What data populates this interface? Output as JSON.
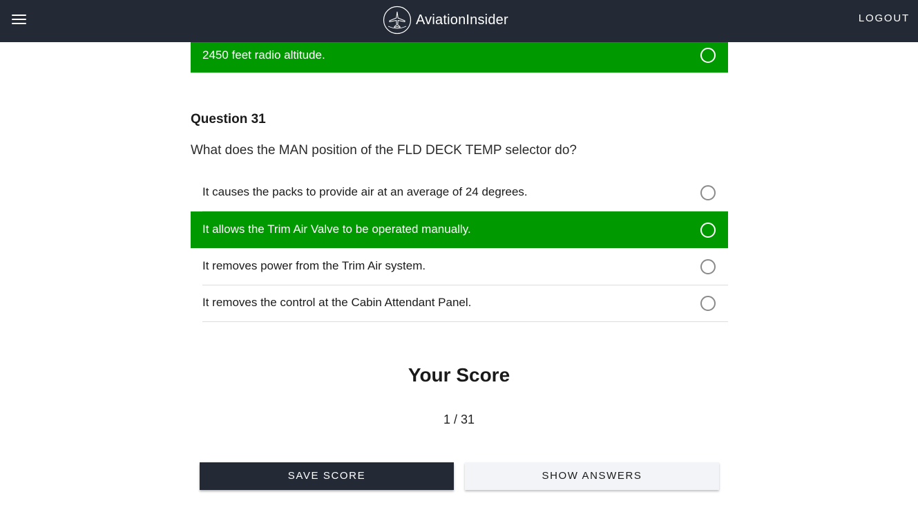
{
  "header": {
    "brand": "AviationInsider",
    "logout_label": "LOGOUT",
    "menu_icon": "hamburger-menu-icon",
    "logo_icon": "airplane-logo-icon",
    "background_color": "#232a36"
  },
  "previous_question": {
    "selected_option": "2450 feet radio altitude."
  },
  "question": {
    "title": "Question 31",
    "text": "What does the MAN position of the FLD DECK TEMP selector do?",
    "options": [
      {
        "label": "It causes the packs to provide air at an average of 24 degrees.",
        "selected": false
      },
      {
        "label": "It allows the Trim Air Valve to be operated manually.",
        "selected": true
      },
      {
        "label": "It removes power from the Trim Air system.",
        "selected": false
      },
      {
        "label": "It removes the control at the Cabin Attendant Panel.",
        "selected": false
      }
    ]
  },
  "score": {
    "title": "Your Score",
    "value": "1 / 31"
  },
  "actions": {
    "save_label": "SAVE SCORE",
    "show_label": "SHOW ANSWERS"
  },
  "colors": {
    "selected": "#009900",
    "dark": "#232a36"
  }
}
